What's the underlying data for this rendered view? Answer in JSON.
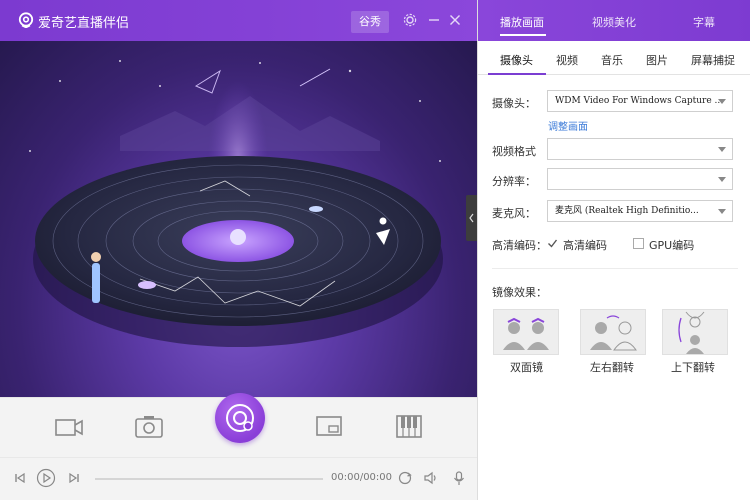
{
  "window": {
    "title": "爱奇艺直播伴侣",
    "mode_button": "谷秀",
    "icons": [
      "iqiyi-logo-icon",
      "settings-icon",
      "minimize-icon",
      "close-icon"
    ]
  },
  "toolbar": {
    "tools": [
      "video-camera-icon",
      "photo-camera-icon",
      "go-live-icon",
      "picture-in-picture-icon",
      "piano-icon"
    ]
  },
  "playback": {
    "time": "00:00/00:00",
    "progress": 0,
    "icons": [
      "previous-icon",
      "play-icon",
      "next-icon",
      "loop-icon",
      "volume-icon",
      "microphone-icon"
    ]
  },
  "right_panel": {
    "tabs": [
      "播放画面",
      "视频美化",
      "字幕"
    ],
    "active_tab": "播放画面",
    "subtabs": [
      "摄像头",
      "视频",
      "音乐",
      "图片",
      "屏幕捕捉"
    ],
    "active_subtab": "摄像头",
    "camera": {
      "camera_label": "摄像头：",
      "camera_value": "WDM Video For Windows Capture ...",
      "adjust_link": "调整画面",
      "format_label": "视频格式",
      "format_value": "",
      "resolution_label": "分辨率：",
      "resolution_value": "",
      "mic_label": "麦克风：",
      "mic_value": "麦克风 (Realtek High Definitio...",
      "hd_label": "高清编码：",
      "hd_option": "高清编码",
      "hd_checked": true,
      "gpu_option": "GPU编码",
      "gpu_checked": false
    },
    "mirror": {
      "label": "镜像效果：",
      "options": [
        "双面镜",
        "左右翻转",
        "上下翻转"
      ]
    }
  },
  "colors": {
    "accent": "#8a46da",
    "link": "#3c7bd8"
  }
}
